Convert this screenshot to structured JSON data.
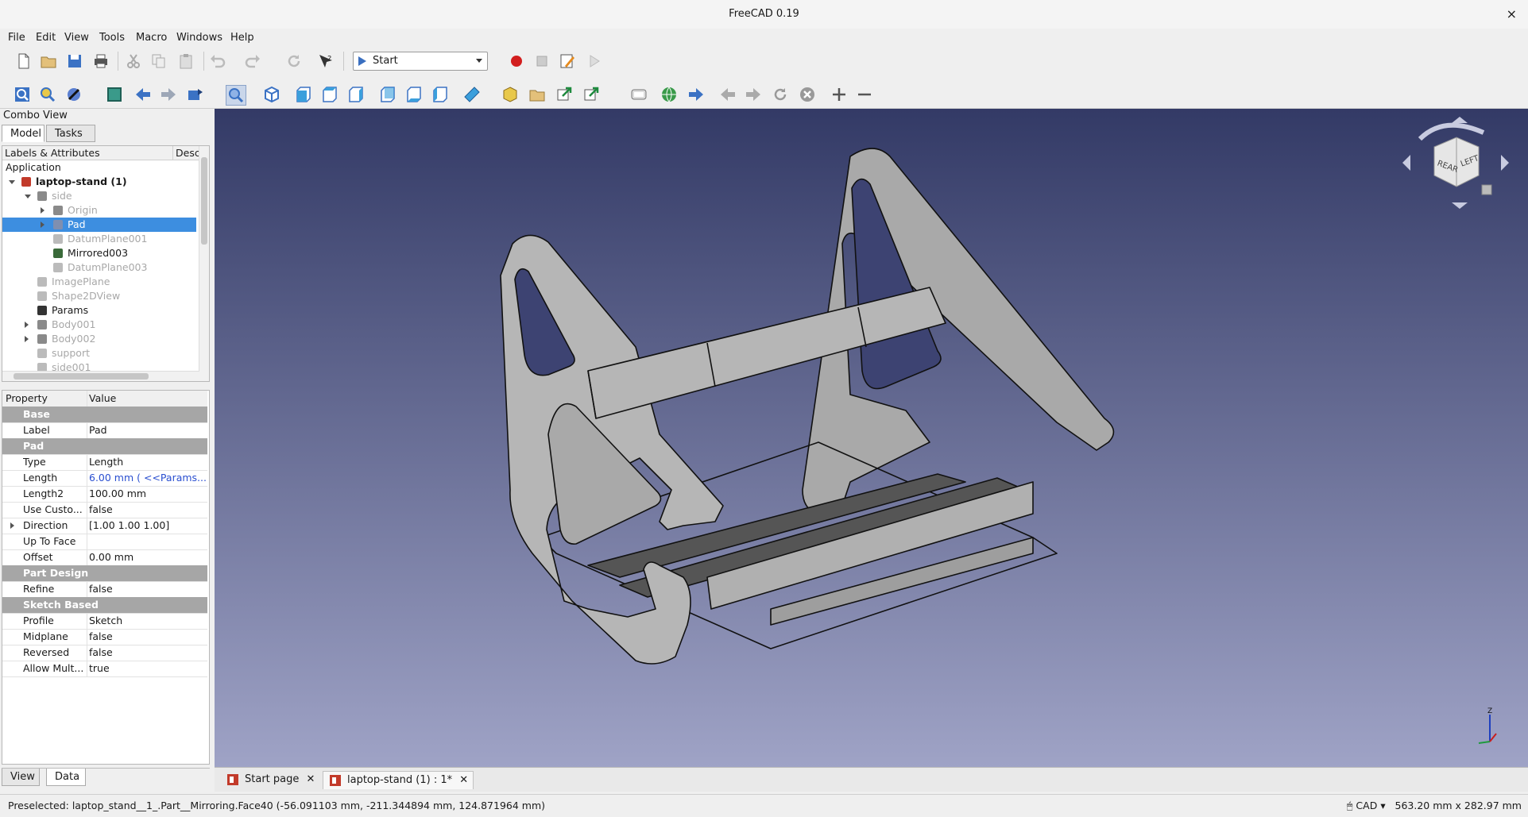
{
  "window": {
    "title": "FreeCAD 0.19",
    "close": "×"
  },
  "menu": [
    "File",
    "Edit",
    "View",
    "Tools",
    "Macro",
    "Windows",
    "Help"
  ],
  "workbench": {
    "selected": "Start"
  },
  "combo": {
    "title": "Combo View",
    "tabs": [
      "Model",
      "Tasks"
    ],
    "bottom_tabs": [
      "View",
      "Data"
    ]
  },
  "tree": {
    "headers": [
      "Labels & Attributes",
      "Desc"
    ],
    "root": "Application",
    "items": [
      {
        "label": "laptop-stand (1)",
        "indent": 0,
        "expand": "down",
        "icon": "document-icon",
        "bold": true,
        "dim": false
      },
      {
        "label": "side",
        "indent": 1,
        "expand": "down",
        "icon": "body-icon",
        "dim": true
      },
      {
        "label": "Origin",
        "indent": 2,
        "expand": "right",
        "icon": "origin-icon",
        "dim": true
      },
      {
        "label": "Pad",
        "indent": 2,
        "expand": "right",
        "icon": "pad-icon",
        "dim": false,
        "selected": true
      },
      {
        "label": "DatumPlane001",
        "indent": 2,
        "expand": "",
        "icon": "datum-plane-icon",
        "dim": true
      },
      {
        "label": "Mirrored003",
        "indent": 2,
        "expand": "",
        "icon": "mirrored-icon",
        "dim": false
      },
      {
        "label": "DatumPlane003",
        "indent": 2,
        "expand": "",
        "icon": "datum-plane-icon",
        "dim": true
      },
      {
        "label": "ImagePlane",
        "indent": 1,
        "expand": "",
        "icon": "image-plane-icon",
        "dim": true
      },
      {
        "label": "Shape2DView",
        "indent": 1,
        "expand": "",
        "icon": "shape-icon",
        "dim": true
      },
      {
        "label": "Params",
        "indent": 1,
        "expand": "",
        "icon": "spreadsheet-icon",
        "dim": false
      },
      {
        "label": "Body001",
        "indent": 1,
        "expand": "right",
        "icon": "body-icon",
        "dim": true
      },
      {
        "label": "Body002",
        "indent": 1,
        "expand": "right",
        "icon": "body-icon",
        "dim": true
      },
      {
        "label": "support",
        "indent": 1,
        "expand": "",
        "icon": "shape-icon",
        "dim": true
      },
      {
        "label": "side001",
        "indent": 1,
        "expand": "",
        "icon": "shape-icon",
        "dim": true
      }
    ]
  },
  "properties": {
    "headers": [
      "Property",
      "Value"
    ],
    "rows": [
      {
        "group": "Base"
      },
      {
        "key": "Label",
        "value": "Pad"
      },
      {
        "group": "Pad"
      },
      {
        "key": "Type",
        "value": "Length"
      },
      {
        "key": "Length",
        "value": "6.00 mm  ( <<Params...",
        "link": true
      },
      {
        "key": "Length2",
        "value": "100.00 mm"
      },
      {
        "key": "Use Custo...",
        "value": "false"
      },
      {
        "key": "Direction",
        "value": "[1.00 1.00 1.00]",
        "expand": true
      },
      {
        "key": "Up To Face",
        "value": ""
      },
      {
        "key": "Offset",
        "value": "0.00 mm"
      },
      {
        "group": "Part Design"
      },
      {
        "key": "Refine",
        "value": "false"
      },
      {
        "group": "Sketch Based"
      },
      {
        "key": "Profile",
        "value": "Sketch"
      },
      {
        "key": "Midplane",
        "value": "false"
      },
      {
        "key": "Reversed",
        "value": "false"
      },
      {
        "key": "Allow Mult...",
        "value": "true"
      }
    ]
  },
  "navcube": {
    "faces": [
      "REAR",
      "LEFT"
    ]
  },
  "axis": {
    "z": "Z"
  },
  "doc_tabs": [
    {
      "label": "Start page",
      "active": false
    },
    {
      "label": "laptop-stand (1) : 1*",
      "active": true
    }
  ],
  "status": {
    "message": "Preselected: laptop_stand__1_.Part__Mirroring.Face40 (-56.091103 mm, -211.344894 mm, 124.871964 mm)",
    "nav_style": "CAD",
    "dimensions": "563.20 mm x 282.97 mm"
  },
  "colors": {
    "selection": "#3d8ee0",
    "viewport_top": "#333a66",
    "viewport_bottom": "#9fa3c6",
    "model": "#b4b4b4"
  }
}
